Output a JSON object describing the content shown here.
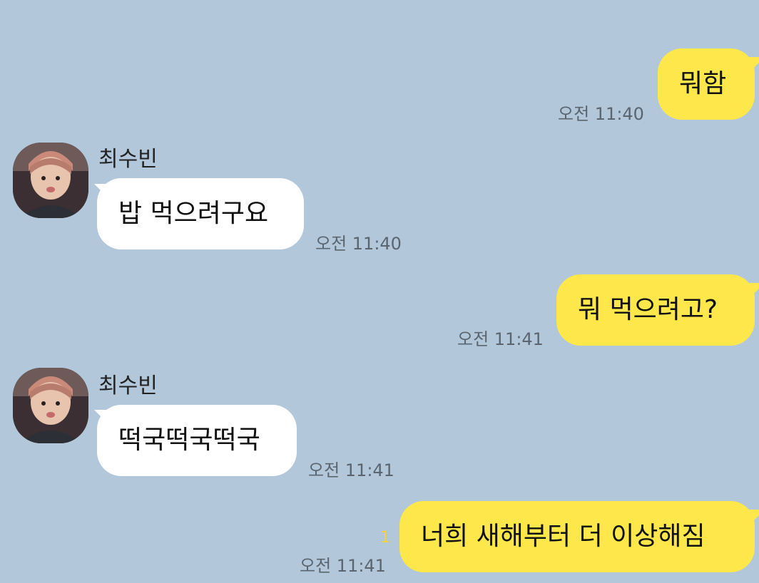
{
  "chat": {
    "contact_name": "최수빈",
    "messages": [
      {
        "from": "me",
        "text": "뭐함",
        "time": "오전 11:40"
      },
      {
        "from": "other",
        "text": "밥 먹으려구요",
        "time": "오전 11:40"
      },
      {
        "from": "me",
        "text": "뭐 먹으려고?",
        "time": "오전 11:41"
      },
      {
        "from": "other",
        "text": "떡국떡국떡국",
        "time": "오전 11:41"
      },
      {
        "from": "me",
        "text": "너희 새해부터 더 이상해짐",
        "time": "오전 11:41",
        "unread": "1"
      }
    ]
  },
  "colors": {
    "background": "#b2c7d9",
    "my_bubble": "#fde74a",
    "their_bubble": "#ffffff",
    "unread": "#f3d33c"
  },
  "icons": {
    "avatar": "profile-photo"
  }
}
